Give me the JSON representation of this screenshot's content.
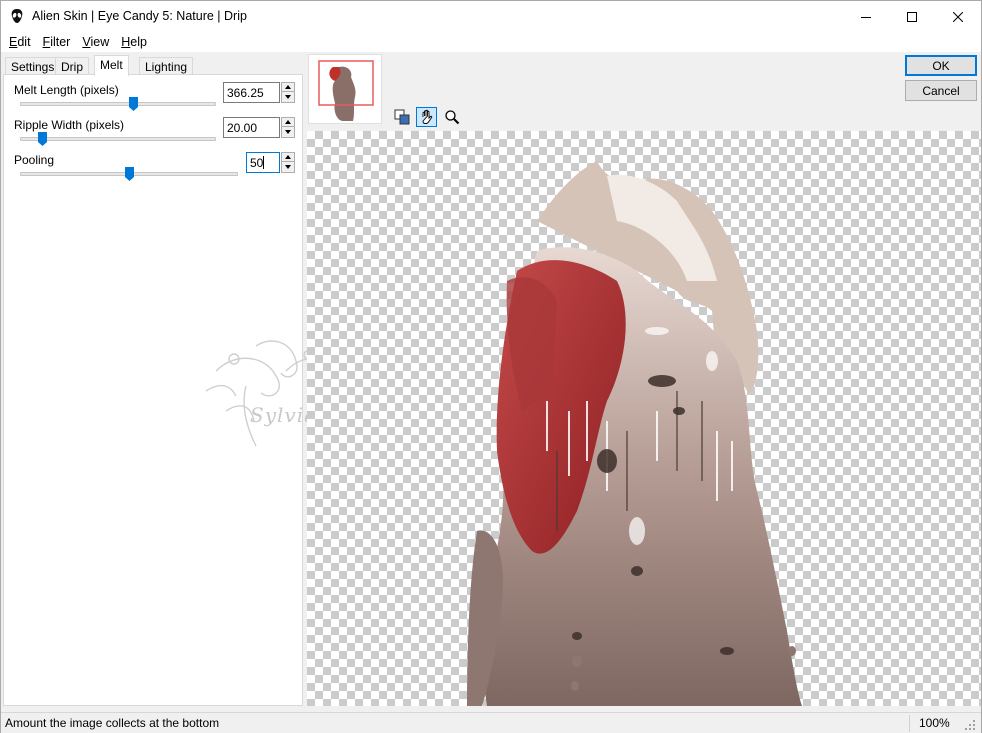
{
  "window": {
    "title": "Alien Skin | Eye Candy 5: Nature | Drip"
  },
  "menu": [
    {
      "label": "Edit",
      "mnemonic": "E",
      "rest": "dit"
    },
    {
      "label": "Filter",
      "mnemonic": "F",
      "rest": "ilter"
    },
    {
      "label": "View",
      "mnemonic": "V",
      "rest": "iew"
    },
    {
      "label": "Help",
      "mnemonic": "H",
      "rest": "elp"
    }
  ],
  "tabs": [
    {
      "label": "Settings",
      "active": false
    },
    {
      "label": "Drip",
      "active": false
    },
    {
      "label": "Melt",
      "active": true
    },
    {
      "label": "Lighting",
      "active": false
    }
  ],
  "params": {
    "melt_length": {
      "label": "Melt Length (pixels)",
      "value": "366.25",
      "slider_fraction": 0.59
    },
    "ripple_width": {
      "label": "Ripple Width (pixels)",
      "value": "20.00",
      "slider_fraction": 0.11
    },
    "pooling": {
      "label": "Pooling",
      "value": "50",
      "slider_fraction": 0.5
    }
  },
  "watermark": {
    "text": "Sylviane"
  },
  "buttons": {
    "ok": "OK",
    "cancel": "Cancel"
  },
  "tools": [
    "compare-icon",
    "hand-icon",
    "zoom-icon"
  ],
  "status": {
    "text": "Amount the image collects at the bottom",
    "zoom": "100%"
  },
  "colors": {
    "accent": "#0078d7",
    "checker": "#cbcbcb",
    "thumb_frame": "#e85c5c"
  }
}
